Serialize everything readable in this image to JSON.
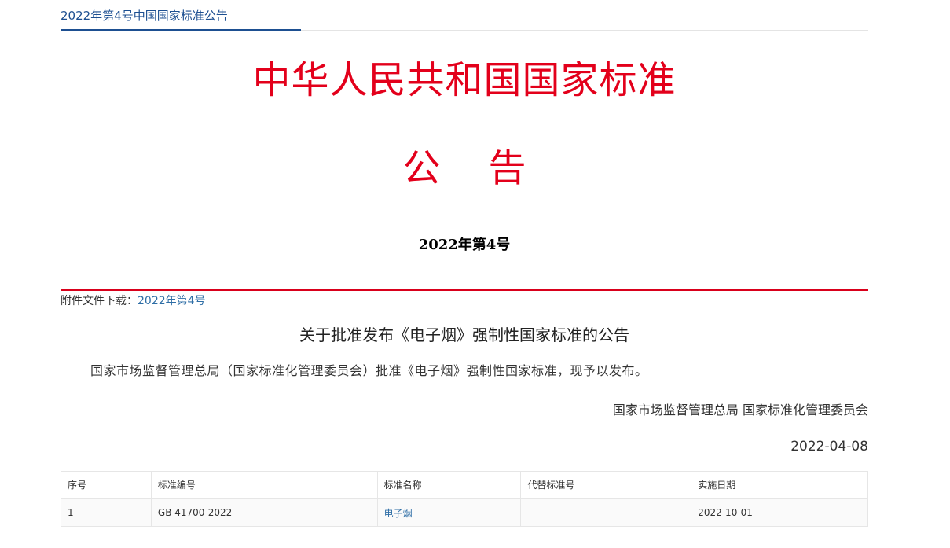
{
  "breadcrumb": {
    "title": "2022年第4号中国国家标准公告"
  },
  "header": {
    "standard_title": "中华人民共和国国家标准",
    "notice_word": "公    告",
    "issue_number": "2022年第4号"
  },
  "attachment": {
    "label": "附件文件下载：",
    "link_text": "2022年第4号"
  },
  "notice": {
    "heading": "关于批准发布《电子烟》强制性国家标准的公告",
    "body": "国家市场监督管理总局（国家标准化管理委员会）批准《电子烟》强制性国家标准，现予以发布。",
    "signature": "国家市场监督管理总局 国家标准化管理委员会",
    "date": "2022-04-08"
  },
  "table": {
    "headers": {
      "seq": "序号",
      "code": "标准编号",
      "name": "标准名称",
      "replaced": "代替标准号",
      "effective": "实施日期"
    },
    "rows": [
      {
        "seq": "1",
        "code": "GB 41700-2022",
        "name": "电子烟",
        "replaced": "",
        "effective": "2022-10-01"
      }
    ]
  },
  "colors": {
    "link_blue": "#2e6ea6",
    "title_red": "#e3001b",
    "rule_red": "#d9001b",
    "crumb_blue": "#1d4f91"
  }
}
